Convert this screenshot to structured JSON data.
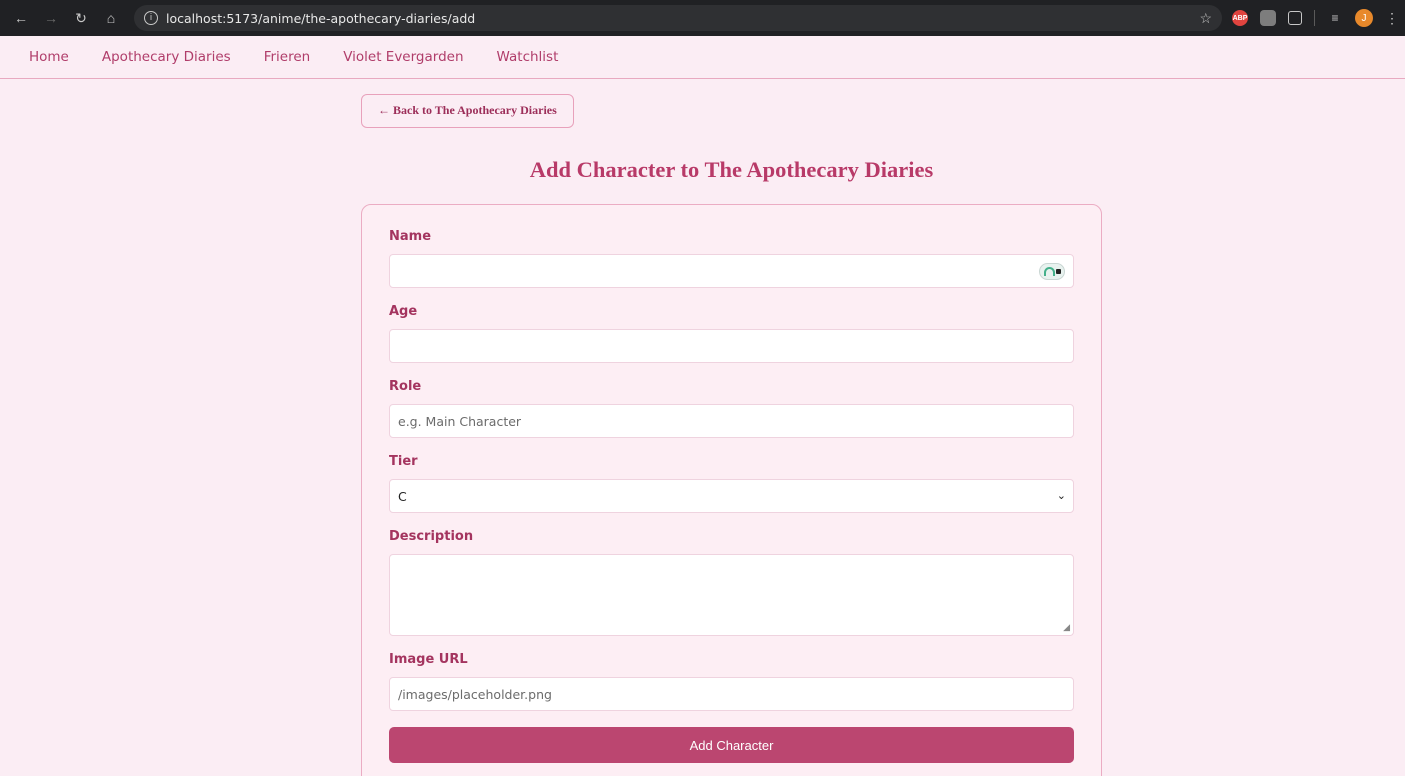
{
  "browser": {
    "url": "localhost:5173/anime/the-apothecary-diaries/add",
    "avatar_letter": "J",
    "ext_abp_label": "ABP"
  },
  "nav": {
    "items": [
      {
        "label": "Home"
      },
      {
        "label": "Apothecary Diaries"
      },
      {
        "label": "Frieren"
      },
      {
        "label": "Violet Evergarden"
      },
      {
        "label": "Watchlist"
      }
    ]
  },
  "back_button": {
    "label": "← Back to The Apothecary Diaries"
  },
  "page_title": "Add Character to The Apothecary Diaries",
  "form": {
    "name": {
      "label": "Name",
      "value": ""
    },
    "age": {
      "label": "Age",
      "value": ""
    },
    "role": {
      "label": "Role",
      "placeholder": "e.g. Main Character",
      "value": ""
    },
    "tier": {
      "label": "Tier",
      "selected": "C"
    },
    "description": {
      "label": "Description",
      "value": ""
    },
    "image_url": {
      "label": "Image URL",
      "value": "/images/placeholder.png"
    },
    "submit_label": "Add Character"
  },
  "colors": {
    "accent": "#bb4670",
    "page_bg": "#fbedf4",
    "label": "#a4345f",
    "title": "#b83a68"
  }
}
